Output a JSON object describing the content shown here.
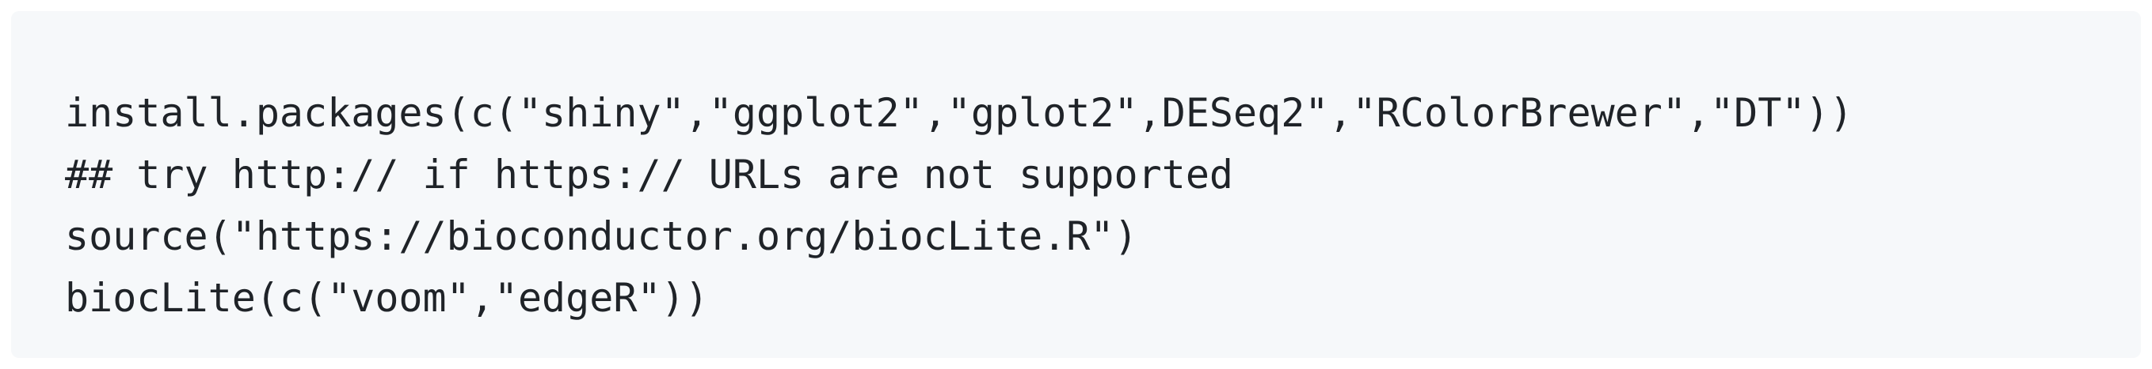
{
  "code_block": {
    "lines": [
      "install.packages(c(\"shiny\",\"ggplot2\",\"gplot2\",DESeq2\",\"RColorBrewer\",\"DT\"))",
      "## try http:// if https:// URLs are not supported",
      "source(\"https://bioconductor.org/biocLite.R\")",
      "biocLite(c(\"voom\",\"edgeR\"))"
    ]
  }
}
